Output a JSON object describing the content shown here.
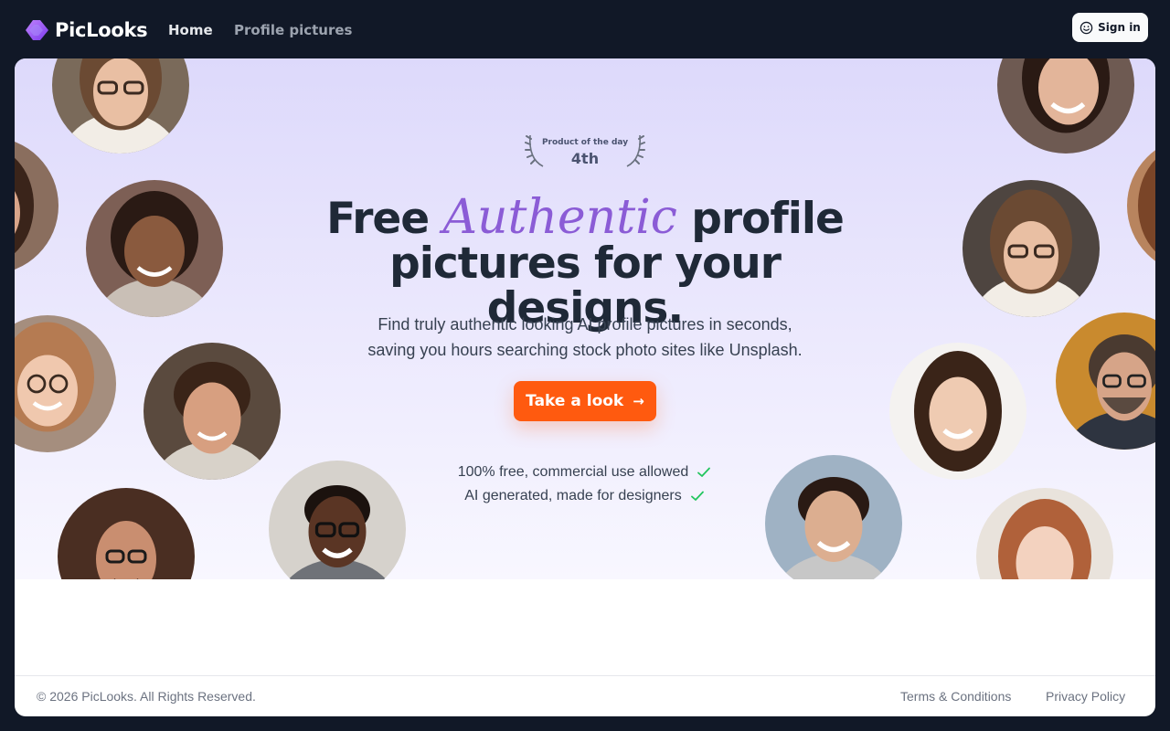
{
  "app": {
    "name": "PicLooks"
  },
  "nav": {
    "items": [
      {
        "label": "Home"
      },
      {
        "label": "Profile pictures"
      }
    ]
  },
  "header": {
    "signin_label": "Sign in"
  },
  "badge": {
    "title": "Product of the day",
    "rank": "4th"
  },
  "hero": {
    "headline_part1": "Free",
    "headline_accent": "Authentic",
    "headline_part2": "profile",
    "headline_line2": "pictures for your designs.",
    "subtitle_line1": "Find truly authentic looking AI profile pictures in seconds,",
    "subtitle_line2": "saving you hours searching stock photo sites like Unsplash.",
    "cta_label": "Take a look",
    "features": [
      {
        "text": "100% free, commercial use allowed"
      },
      {
        "text": "AI generated, made for designers"
      }
    ]
  },
  "footer": {
    "copyright": "© 2026 PicLooks. All Rights Reserved.",
    "links": [
      {
        "label": "Terms & Conditions"
      },
      {
        "label": "Privacy Policy"
      }
    ]
  },
  "colors": {
    "page_bg": "#111827",
    "accent_purple": "#8b5cd6",
    "cta_orange": "#ff5a0f",
    "check_green": "#22c55e",
    "hero_bg_top": "#ddd9fb"
  }
}
